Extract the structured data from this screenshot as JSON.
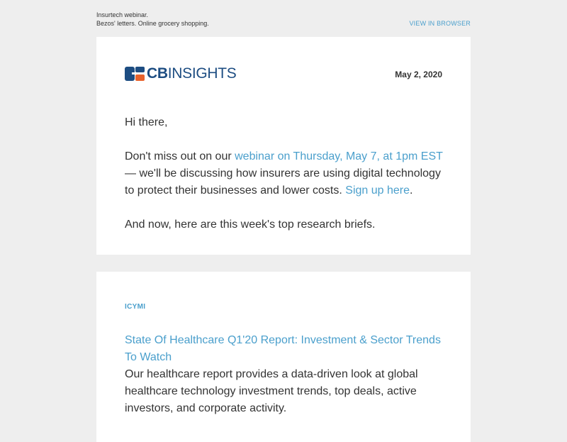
{
  "preheader": {
    "line1": "Insurtech webinar.",
    "line2": "Bezos' letters. Online grocery shopping.",
    "view_in_browser": "VIEW IN BROWSER"
  },
  "header": {
    "logo_bold": "CB",
    "logo_light": "INSIGHTS",
    "date": "May 2, 2020"
  },
  "intro": {
    "greeting": "Hi there,",
    "para1_prefix": "Don't miss out on our ",
    "para1_link": "webinar on Thursday, May 7, at 1pm EST",
    "para1_middle": " — we'll be discussing how insurers are using digital technology to protect their businesses and lower costs. ",
    "para1_signup": "Sign up here",
    "para1_suffix": ".",
    "para2": "And now, here are this week's top research briefs."
  },
  "article": {
    "eyebrow": "ICYMI",
    "title": "State Of Healthcare Q1'20 Report: Investment & Sector Trends To Watch",
    "description": "Our healthcare report provides a data-driven look at global healthcare technology investment trends, top deals, active investors, and corporate activity."
  },
  "colors": {
    "background": "#eeeeee",
    "card": "#ffffff",
    "link": "#4a9fcc",
    "brand_navy": "#1d4d82",
    "brand_orange": "#e8622c",
    "text": "#333333"
  }
}
